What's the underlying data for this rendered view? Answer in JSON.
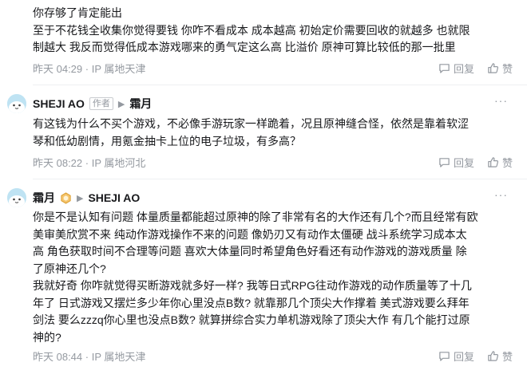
{
  "comments": [
    {
      "lines": [
        "你存够了肯定能出",
        "至于不花钱全收集你觉得要钱 你咋不看成本 成本越高 初始定价需要回收的就越多 也就限",
        "制越大 我反而觉得低成本游戏哪来的勇气定这么高 比溢价 原神可算比较低的那一批里"
      ],
      "time": "昨天 04:29",
      "ip": "IP 属地天津",
      "reply_label": "回复",
      "like_label": "赞"
    },
    {
      "author": "SHEJI AO",
      "role_tag": "作者",
      "reply_to": "霜月",
      "lines": [
        "有这钱为什么不买个游戏，不必像手游玩家一样跪着，况且原神缝合怪，依然是靠着软涩",
        "琴和低幼剧情，用氪金抽卡上位的电子垃圾，有多高？"
      ],
      "time": "昨天 08:22",
      "ip": "IP 属地河北",
      "reply_label": "回复",
      "like_label": "赞"
    },
    {
      "author": "霜月",
      "reply_to": "SHEJI AO",
      "lines": [
        "你是不是认知有问题 体量质量都能超过原神的除了非常有名的大作还有几个?而且经常有欧",
        "美审美欣赏不来 纯动作游戏操作不来的问题 像奶刃又有动作太僵硬 战斗系统学习成本太",
        "高 角色获取时间不合理等问题 喜欢大体量同时希望角色好看还有动作游戏的游戏质量 除",
        "了原神还几个?",
        "我就好奇 你咋就觉得买断游戏就多好一样? 我等日式RPG往动作游戏的动作质量等了十几",
        "年了 日式游戏又摆烂多少年你心里没点B数? 就靠那几个顶尖大作撑着 美式游戏要么拜年",
        "剑法 要么zzzq你心里也没点B数? 就算拼综合实力单机游戏除了顶尖大作 有几个能打过原",
        "神的?"
      ],
      "time": "昨天 08:44",
      "ip": "IP 属地天津",
      "reply_label": "回复",
      "like_label": "赞"
    }
  ],
  "meta_separator": "·",
  "more_label": "···",
  "reply_arrow": "▶",
  "icons": {
    "reply": "reply-icon",
    "like": "thumbs-up-icon",
    "avatar": "avatar-icon",
    "badge": "level-badge-icon"
  },
  "colors": {
    "text": "#18191c",
    "meta": "#9499a0",
    "divider": "#eef0f2"
  }
}
